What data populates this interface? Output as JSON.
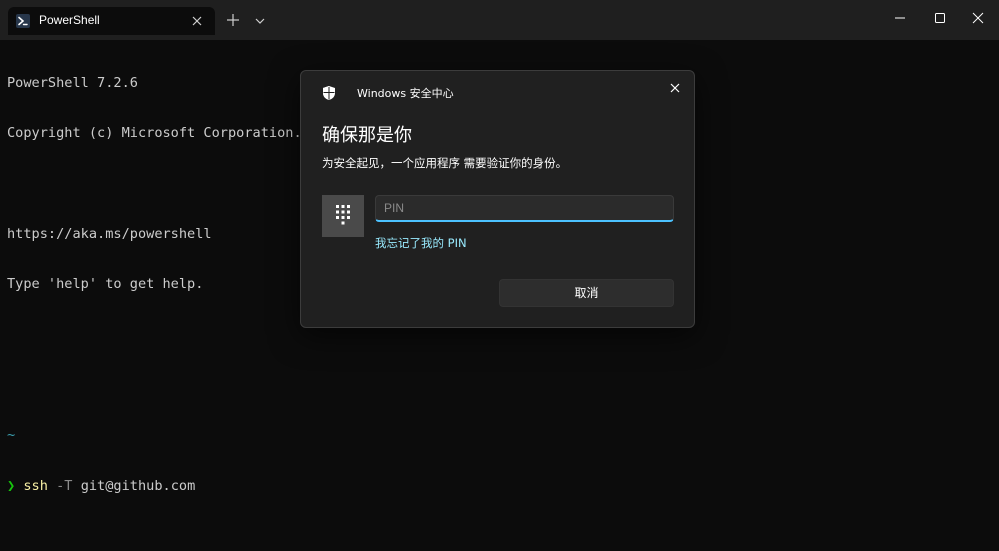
{
  "titlebar": {
    "tab_title": "PowerShell",
    "tab_icon": "powershell-icon",
    "controls": [
      "minimize-icon",
      "maximize-icon",
      "close-icon"
    ]
  },
  "terminal": {
    "lines": [
      "PowerShell 7.2.6",
      "Copyright (c) Microsoft Corporation.",
      "",
      "https://aka.ms/powershell",
      "Type 'help' to get help."
    ],
    "cwd": "~",
    "prompt_glyph": "❯",
    "command": "ssh",
    "flag": "-T",
    "argument": "git@github.com"
  },
  "dialog": {
    "app_title": "Windows 安全中心",
    "heading": "确保那是你",
    "subtitle": "为安全起见，一个应用程序 需要验证你的身份。",
    "pin_placeholder": "PIN",
    "pin_value": "",
    "forgot_link": "我忘记了我的 PIN",
    "cancel_label": "取消",
    "accent_color": "#4cc2ff",
    "link_color": "#99ebff"
  }
}
